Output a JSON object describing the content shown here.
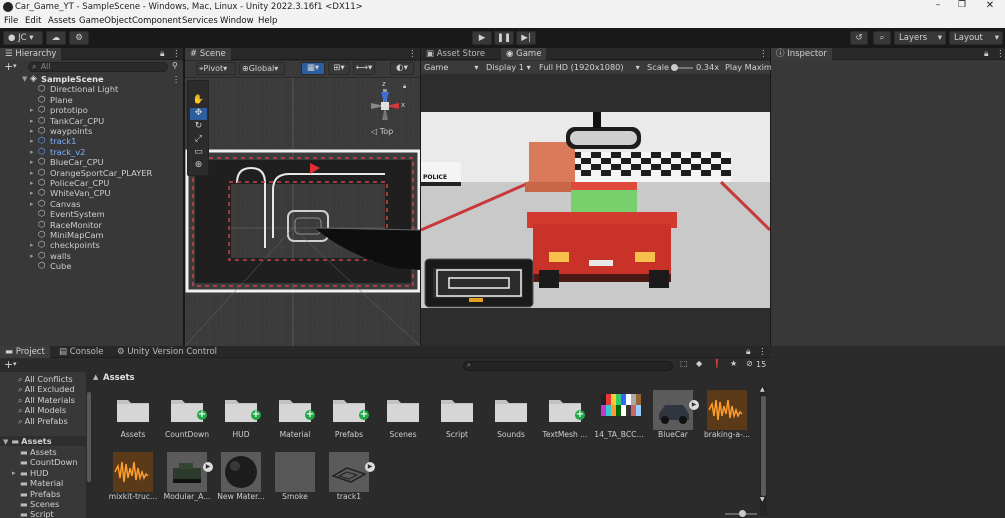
{
  "window": {
    "title": "Car_Game_YT - SampleScene - Windows, Mac, Linux - Unity 2022.3.16f1 <DX11>"
  },
  "menu": [
    "File",
    "Edit",
    "Assets",
    "GameObject",
    "Component",
    "Services",
    "Window",
    "Help"
  ],
  "toolbar": {
    "account": "JC",
    "layers": "Layers",
    "layout": "Layout"
  },
  "hierarchy": {
    "title": "Hierarchy",
    "search_placeholder": "All",
    "scene": "SampleScene",
    "items": [
      {
        "label": "Directional Light",
        "arrow": false,
        "blue": false
      },
      {
        "label": "Plane",
        "arrow": false,
        "blue": false
      },
      {
        "label": "prototipo",
        "arrow": true,
        "blue": false
      },
      {
        "label": "TankCar_CPU",
        "arrow": true,
        "blue": false
      },
      {
        "label": "waypoints",
        "arrow": true,
        "blue": false
      },
      {
        "label": "track1",
        "arrow": true,
        "blue": true
      },
      {
        "label": "track_v2",
        "arrow": true,
        "blue": true
      },
      {
        "label": "BlueCar_CPU",
        "arrow": true,
        "blue": false
      },
      {
        "label": "OrangeSportCar_PLAYER",
        "arrow": true,
        "blue": false
      },
      {
        "label": "PoliceCar_CPU",
        "arrow": true,
        "blue": false
      },
      {
        "label": "WhiteVan_CPU",
        "arrow": true,
        "blue": false
      },
      {
        "label": "Canvas",
        "arrow": true,
        "blue": false
      },
      {
        "label": "EventSystem",
        "arrow": false,
        "blue": false
      },
      {
        "label": "RaceMonitor",
        "arrow": false,
        "blue": false
      },
      {
        "label": "MiniMapCam",
        "arrow": false,
        "blue": false
      },
      {
        "label": "checkpoints",
        "arrow": true,
        "blue": false
      },
      {
        "label": "walls",
        "arrow": true,
        "blue": false
      },
      {
        "label": "Cube",
        "arrow": false,
        "blue": false
      }
    ]
  },
  "scene": {
    "tab": "Scene",
    "pivot": "Pivot",
    "global": "Global",
    "view_label": "Top",
    "gizmo_axes": {
      "x": "x",
      "z": "z"
    }
  },
  "game": {
    "tabs": [
      "Asset Store",
      "Game"
    ],
    "display_mode": "Game",
    "display": "Display 1",
    "resolution": "Full HD (1920x1080)",
    "scale_label": "Scale",
    "scale_value": "0.34x",
    "play_max": "Play Maxim",
    "police_text": "POLICE"
  },
  "inspector": {
    "title": "Inspector"
  },
  "project": {
    "tabs": [
      "Project",
      "Console",
      "Unity Version Control"
    ],
    "favorites": [
      "All Conflicts",
      "All Excluded",
      "All Materials",
      "All Models",
      "All Prefabs"
    ],
    "tree_root": "Assets",
    "tree": [
      {
        "label": "Assets",
        "arrow": false
      },
      {
        "label": "CountDown",
        "arrow": false
      },
      {
        "label": "HUD",
        "arrow": true
      },
      {
        "label": "Material",
        "arrow": false
      },
      {
        "label": "Prefabs",
        "arrow": false
      },
      {
        "label": "Scenes",
        "arrow": false
      },
      {
        "label": "Script",
        "arrow": false
      }
    ],
    "breadcrumb": "Assets",
    "hidden_count": "15",
    "assets_row1": [
      {
        "label": "Assets",
        "kind": "folder",
        "badge": false
      },
      {
        "label": "CountDown",
        "kind": "folder",
        "badge": true
      },
      {
        "label": "HUD",
        "kind": "folder",
        "badge": true
      },
      {
        "label": "Material",
        "kind": "folder",
        "badge": true
      },
      {
        "label": "Prefabs",
        "kind": "folder",
        "badge": true
      },
      {
        "label": "Scenes",
        "kind": "folder",
        "badge": false
      },
      {
        "label": "Script",
        "kind": "folder",
        "badge": false
      },
      {
        "label": "Sounds",
        "kind": "folder",
        "badge": false
      },
      {
        "label": "TextMesh ...",
        "kind": "folder",
        "badge": true
      },
      {
        "label": "14_TA_BCC...",
        "kind": "palette",
        "badge": false
      },
      {
        "label": "BlueCar",
        "kind": "car",
        "badge": false
      },
      {
        "label": "braking-a-...",
        "kind": "audio",
        "badge": false
      }
    ],
    "assets_row2": [
      {
        "label": "mixkit-truc...",
        "kind": "audio"
      },
      {
        "label": "Modular_A...",
        "kind": "tank"
      },
      {
        "label": "New Mater...",
        "kind": "sphere"
      },
      {
        "label": "Smoke",
        "kind": "smoke"
      },
      {
        "label": "track1",
        "kind": "track"
      }
    ]
  }
}
